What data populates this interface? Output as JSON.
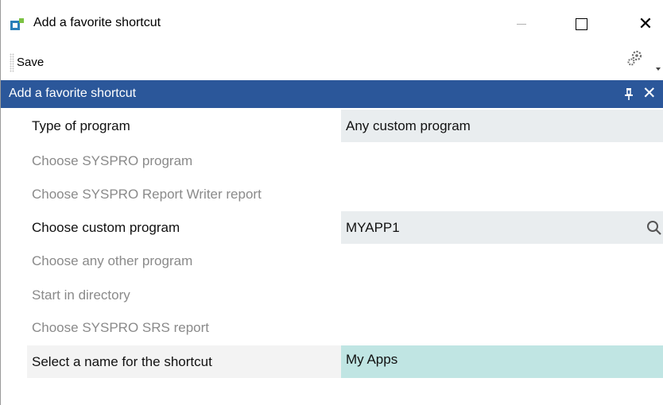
{
  "window": {
    "title": "Add a favorite shortcut"
  },
  "toolbar": {
    "save_label": "Save"
  },
  "panel": {
    "title": "Add a favorite shortcut"
  },
  "fields": [
    {
      "label": "Type of program",
      "value": "Any custom program",
      "enabled": true
    },
    {
      "label": "Choose SYSPRO program",
      "value": "",
      "enabled": false
    },
    {
      "label": "Choose SYSPRO Report Writer report",
      "value": "",
      "enabled": false
    },
    {
      "label": "Choose custom program",
      "value": "MYAPP1",
      "enabled": true
    },
    {
      "label": "Choose any other program",
      "value": "",
      "enabled": false
    },
    {
      "label": "Start in directory",
      "value": "",
      "enabled": false
    },
    {
      "label": "Choose SYSPRO SRS report",
      "value": "",
      "enabled": false
    },
    {
      "label": "Select a name for the shortcut",
      "value": "My Apps",
      "enabled": true
    }
  ],
  "icons": {
    "app": "app-icon",
    "settings": "gear-icon",
    "pin": "pin-icon",
    "search": "search-icon"
  },
  "colors": {
    "panel_header": "#2b579a",
    "field_bg": "#e9edef",
    "name_field_bg": "#c0e5e3",
    "disabled_text": "#8a8a8a"
  }
}
